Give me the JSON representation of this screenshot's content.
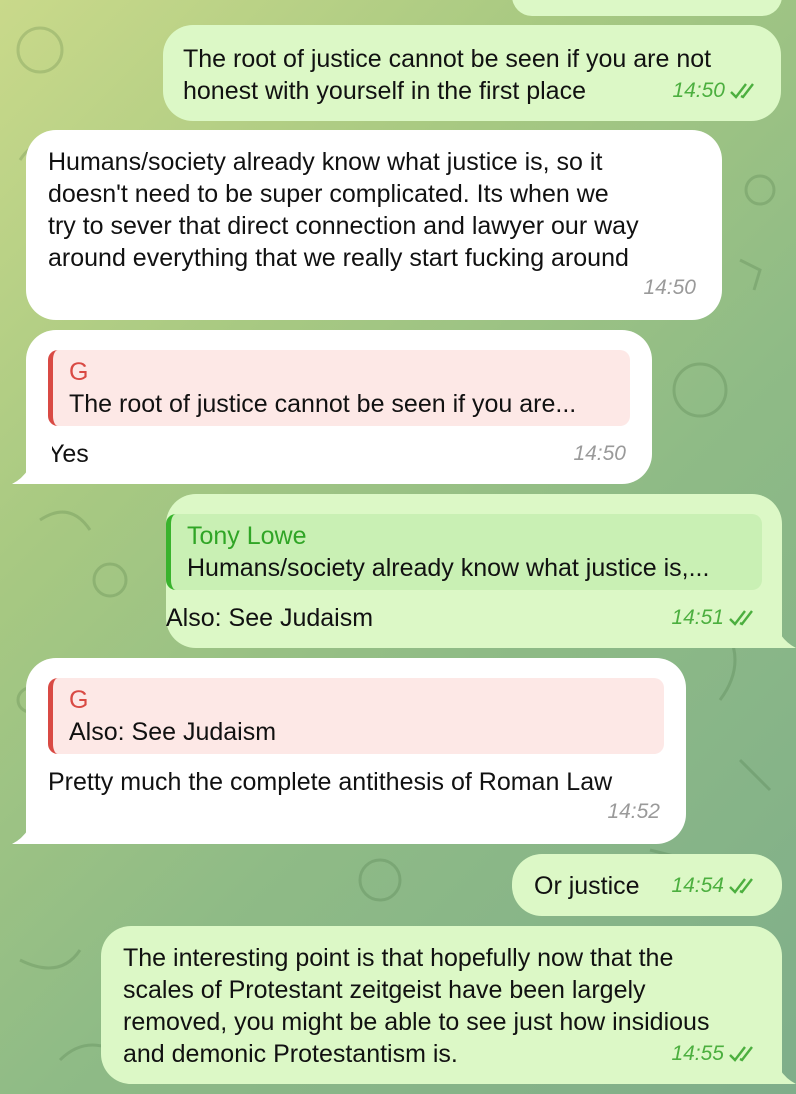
{
  "messages": [
    {
      "id": "m1",
      "dir": "out",
      "text": "The root of justice cannot be seen if you are not\nhonest with yourself in the first place",
      "time": "14:50"
    },
    {
      "id": "m2",
      "dir": "in",
      "text": "Humans/society already know what justice is, so it\ndoesn't need to be super complicated. Its when we\ntry to sever that direct connection and lawyer our way\naround everything that we really start fucking around",
      "time": "14:50"
    },
    {
      "id": "m3",
      "dir": "in",
      "quote": {
        "name": "G",
        "text": "The root of justice cannot be seen if you are..."
      },
      "text": "Yes",
      "time": "14:50"
    },
    {
      "id": "m4",
      "dir": "out",
      "quote": {
        "name": "Tony Lowe",
        "text": "Humans/society already know what justice is,..."
      },
      "text": "Also: See Judaism",
      "time": "14:51"
    },
    {
      "id": "m5",
      "dir": "in",
      "quote": {
        "name": "G",
        "text": "Also: See Judaism"
      },
      "text": "Pretty much the complete antithesis of Roman Law",
      "time": "14:52"
    },
    {
      "id": "m6",
      "dir": "out",
      "text": "Or justice",
      "time": "14:54"
    },
    {
      "id": "m7",
      "dir": "out",
      "text": "The interesting point is that hopefully now that the\nscales of Protestant zeitgeist have been largely\nremoved, you might be able to see just how insidious\nand demonic Protestantism is.",
      "time": "14:55"
    }
  ],
  "colors": {
    "incoming": "#ffffff",
    "outgoing": "#dcf8c6",
    "quote_red": "#d94a44",
    "quote_green": "#30a526"
  }
}
